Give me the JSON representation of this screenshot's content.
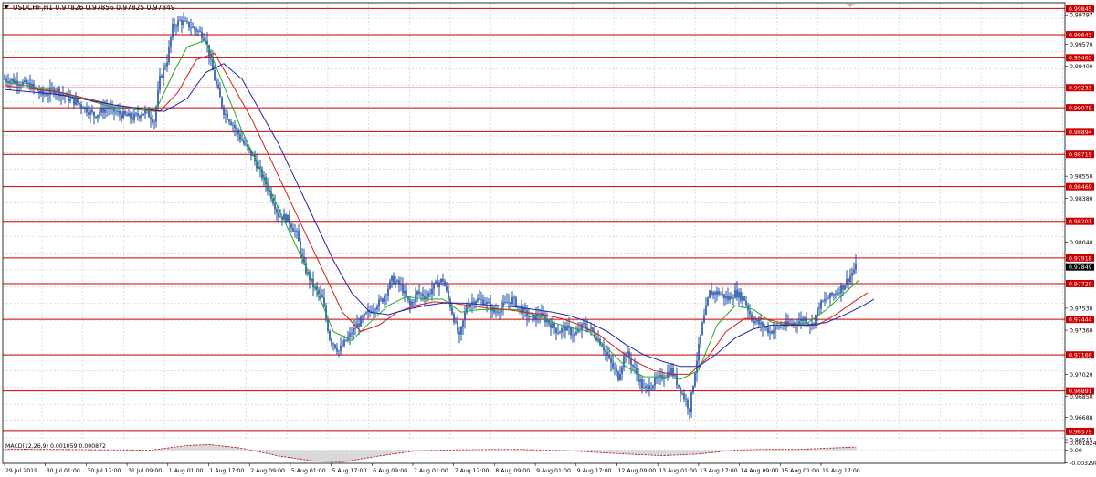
{
  "header": {
    "symbol_line": "USDCHF,H1  0.97826 0.97856 0.97825 0.97849"
  },
  "colors": {
    "background": "#ffffff",
    "grid": "#c8c8c8",
    "candles": "#1f4fa8",
    "sr_lines": "#cc0000",
    "ma_fast": "#22aa22",
    "ma_mid": "#cc2222",
    "ma_slow": "#2222aa",
    "macd_hist": "#a0a0a0",
    "macd_signal": "#cc0000",
    "price_label_bg": "#cc0000",
    "current_price_bg": "#000000"
  },
  "price_axis": {
    "plain_labels": [
      "0.99797",
      "0.99570",
      "0.99400",
      "0.98550",
      "0.98380",
      "0.98040",
      "0.97530",
      "0.97360",
      "0.97020",
      "0.96850",
      "0.96688",
      "0.96515"
    ],
    "current_price": "0.97849"
  },
  "sr_levels": [
    "0.99845",
    "0.99643",
    "0.99465",
    "0.99233",
    "0.99079",
    "0.98894",
    "0.98719",
    "0.98469",
    "0.98201",
    "0.97918",
    "0.97720",
    "0.97444",
    "0.97169",
    "0.96891",
    "0.96579"
  ],
  "time_axis": {
    "labels": [
      "29 Jul 2019",
      "30 Jul 01:00",
      "30 Jul 17:00",
      "31 Jul 09:00",
      "1 Aug 01:00",
      "1 Aug 17:00",
      "2 Aug 09:00",
      "5 Aug 01:00",
      "5 Aug 17:00",
      "6 Aug 09:00",
      "7 Aug 01:00",
      "7 Aug 17:00",
      "8 Aug 09:00",
      "9 Aug 01:00",
      "9 Aug 17:00",
      "12 Aug 09:00",
      "13 Aug 01:00",
      "13 Aug 17:00",
      "14 Aug 09:00",
      "15 Aug 01:00",
      "15 Aug 17:00"
    ]
  },
  "macd": {
    "label": "MACD(12,26,9) 0.001059 0.000872",
    "axis_labels": [
      "0.001824",
      "0.00",
      "-0.003298"
    ]
  },
  "chart_data": {
    "type": "candlestick",
    "title": "USDCHF,H1",
    "ylim": [
      0.96515,
      0.9989
    ],
    "x_start": "29 Jul 2019",
    "close_path": [
      [
        0,
        0.993
      ],
      [
        14,
        0.9928
      ],
      [
        28,
        0.9925
      ],
      [
        42,
        0.9918
      ],
      [
        56,
        0.9922
      ],
      [
        70,
        0.9915
      ],
      [
        84,
        0.991
      ],
      [
        98,
        0.9902
      ],
      [
        112,
        0.9908
      ],
      [
        126,
        0.9903
      ],
      [
        140,
        0.99
      ],
      [
        154,
        0.9905
      ],
      [
        164,
        0.9898
      ],
      [
        170,
        0.993
      ],
      [
        178,
        0.9945
      ],
      [
        184,
        0.997
      ],
      [
        192,
        0.9975
      ],
      [
        200,
        0.9972
      ],
      [
        210,
        0.9968
      ],
      [
        220,
        0.9962
      ],
      [
        230,
        0.993
      ],
      [
        240,
        0.9905
      ],
      [
        250,
        0.9895
      ],
      [
        262,
        0.988
      ],
      [
        272,
        0.987
      ],
      [
        282,
        0.9855
      ],
      [
        292,
        0.984
      ],
      [
        300,
        0.9825
      ],
      [
        310,
        0.9822
      ],
      [
        320,
        0.981
      ],
      [
        328,
        0.9785
      ],
      [
        338,
        0.977
      ],
      [
        348,
        0.976
      ],
      [
        356,
        0.973
      ],
      [
        366,
        0.972
      ],
      [
        376,
        0.973
      ],
      [
        386,
        0.974
      ],
      [
        396,
        0.9748
      ],
      [
        406,
        0.9755
      ],
      [
        414,
        0.976
      ],
      [
        424,
        0.9775
      ],
      [
        434,
        0.977
      ],
      [
        444,
        0.9755
      ],
      [
        452,
        0.9765
      ],
      [
        462,
        0.9762
      ],
      [
        470,
        0.977
      ],
      [
        480,
        0.9775
      ],
      [
        490,
        0.975
      ],
      [
        498,
        0.973
      ],
      [
        506,
        0.9755
      ],
      [
        516,
        0.976
      ],
      [
        526,
        0.9758
      ],
      [
        536,
        0.975
      ],
      [
        546,
        0.9755
      ],
      [
        556,
        0.976
      ],
      [
        566,
        0.9752
      ],
      [
        576,
        0.9745
      ],
      [
        586,
        0.9748
      ],
      [
        596,
        0.9742
      ],
      [
        606,
        0.9735
      ],
      [
        614,
        0.9738
      ],
      [
        624,
        0.9732
      ],
      [
        634,
        0.974
      ],
      [
        644,
        0.9735
      ],
      [
        654,
        0.9725
      ],
      [
        664,
        0.971
      ],
      [
        672,
        0.97
      ],
      [
        680,
        0.972
      ],
      [
        690,
        0.9705
      ],
      [
        700,
        0.969
      ],
      [
        710,
        0.9695
      ],
      [
        720,
        0.97
      ],
      [
        730,
        0.9705
      ],
      [
        740,
        0.969
      ],
      [
        750,
        0.9675
      ],
      [
        756,
        0.9705
      ],
      [
        764,
        0.974
      ],
      [
        772,
        0.9765
      ],
      [
        782,
        0.9765
      ],
      [
        792,
        0.976
      ],
      [
        800,
        0.9765
      ],
      [
        810,
        0.976
      ],
      [
        818,
        0.9745
      ],
      [
        828,
        0.974
      ],
      [
        838,
        0.9735
      ],
      [
        846,
        0.9738
      ],
      [
        856,
        0.974
      ],
      [
        866,
        0.9742
      ],
      [
        876,
        0.9745
      ],
      [
        884,
        0.974
      ],
      [
        892,
        0.9755
      ],
      [
        900,
        0.976
      ],
      [
        910,
        0.9765
      ],
      [
        918,
        0.977
      ],
      [
        926,
        0.9778
      ],
      [
        932,
        0.9785
      ]
    ],
    "ma_fast_path": [
      [
        0,
        0.9928
      ],
      [
        60,
        0.992
      ],
      [
        120,
        0.9908
      ],
      [
        165,
        0.9905
      ],
      [
        185,
        0.9935
      ],
      [
        200,
        0.9955
      ],
      [
        220,
        0.996
      ],
      [
        240,
        0.9925
      ],
      [
        260,
        0.989
      ],
      [
        280,
        0.986
      ],
      [
        300,
        0.983
      ],
      [
        320,
        0.98
      ],
      [
        340,
        0.977
      ],
      [
        360,
        0.9735
      ],
      [
        380,
        0.9728
      ],
      [
        400,
        0.9742
      ],
      [
        420,
        0.9755
      ],
      [
        440,
        0.9762
      ],
      [
        460,
        0.976
      ],
      [
        480,
        0.976
      ],
      [
        500,
        0.975
      ],
      [
        520,
        0.9752
      ],
      [
        540,
        0.9752
      ],
      [
        560,
        0.9752
      ],
      [
        580,
        0.9748
      ],
      [
        600,
        0.9742
      ],
      [
        620,
        0.9738
      ],
      [
        640,
        0.9735
      ],
      [
        660,
        0.9722
      ],
      [
        680,
        0.9708
      ],
      [
        700,
        0.97
      ],
      [
        720,
        0.97
      ],
      [
        740,
        0.9698
      ],
      [
        760,
        0.9705
      ],
      [
        780,
        0.974
      ],
      [
        800,
        0.9755
      ],
      [
        820,
        0.9752
      ],
      [
        840,
        0.9742
      ],
      [
        860,
        0.974
      ],
      [
        880,
        0.9742
      ],
      [
        900,
        0.9752
      ],
      [
        920,
        0.9765
      ],
      [
        936,
        0.9775
      ]
    ],
    "ma_mid_path": [
      [
        0,
        0.9925
      ],
      [
        60,
        0.992
      ],
      [
        120,
        0.991
      ],
      [
        170,
        0.9905
      ],
      [
        190,
        0.992
      ],
      [
        210,
        0.9945
      ],
      [
        230,
        0.995
      ],
      [
        250,
        0.9925
      ],
      [
        270,
        0.99
      ],
      [
        290,
        0.987
      ],
      [
        310,
        0.984
      ],
      [
        330,
        0.981
      ],
      [
        350,
        0.978
      ],
      [
        370,
        0.975
      ],
      [
        390,
        0.9735
      ],
      [
        410,
        0.974
      ],
      [
        430,
        0.975
      ],
      [
        450,
        0.9755
      ],
      [
        470,
        0.9758
      ],
      [
        490,
        0.9757
      ],
      [
        510,
        0.9755
      ],
      [
        530,
        0.9753
      ],
      [
        550,
        0.9752
      ],
      [
        570,
        0.975
      ],
      [
        590,
        0.9748
      ],
      [
        610,
        0.9745
      ],
      [
        630,
        0.974
      ],
      [
        650,
        0.9733
      ],
      [
        670,
        0.9722
      ],
      [
        690,
        0.9712
      ],
      [
        710,
        0.9705
      ],
      [
        730,
        0.9702
      ],
      [
        750,
        0.9702
      ],
      [
        770,
        0.9715
      ],
      [
        790,
        0.9735
      ],
      [
        810,
        0.9745
      ],
      [
        830,
        0.9745
      ],
      [
        850,
        0.9742
      ],
      [
        870,
        0.974
      ],
      [
        890,
        0.974
      ],
      [
        910,
        0.9748
      ],
      [
        930,
        0.9758
      ],
      [
        945,
        0.9765
      ]
    ],
    "ma_slow_path": [
      [
        0,
        0.9922
      ],
      [
        60,
        0.9918
      ],
      [
        120,
        0.991
      ],
      [
        175,
        0.9905
      ],
      [
        200,
        0.9915
      ],
      [
        220,
        0.9935
      ],
      [
        240,
        0.9942
      ],
      [
        260,
        0.993
      ],
      [
        280,
        0.9905
      ],
      [
        300,
        0.988
      ],
      [
        320,
        0.985
      ],
      [
        340,
        0.982
      ],
      [
        360,
        0.979
      ],
      [
        380,
        0.9765
      ],
      [
        400,
        0.975
      ],
      [
        420,
        0.9748
      ],
      [
        440,
        0.9752
      ],
      [
        460,
        0.9755
      ],
      [
        480,
        0.9757
      ],
      [
        500,
        0.9757
      ],
      [
        520,
        0.9756
      ],
      [
        540,
        0.9755
      ],
      [
        560,
        0.9754
      ],
      [
        580,
        0.9752
      ],
      [
        600,
        0.975
      ],
      [
        620,
        0.9747
      ],
      [
        640,
        0.9742
      ],
      [
        660,
        0.9735
      ],
      [
        680,
        0.9725
      ],
      [
        700,
        0.9717
      ],
      [
        720,
        0.9712
      ],
      [
        740,
        0.9708
      ],
      [
        760,
        0.9708
      ],
      [
        780,
        0.9718
      ],
      [
        800,
        0.973
      ],
      [
        820,
        0.9737
      ],
      [
        840,
        0.974
      ],
      [
        860,
        0.974
      ],
      [
        880,
        0.974
      ],
      [
        900,
        0.9742
      ],
      [
        920,
        0.9748
      ],
      [
        940,
        0.9755
      ],
      [
        952,
        0.976
      ]
    ],
    "macd_signal_path": [
      [
        0,
        0.0003
      ],
      [
        100,
        0.0001
      ],
      [
        160,
        0.0
      ],
      [
        200,
        0.0012
      ],
      [
        225,
        0.0014
      ],
      [
        260,
        0.0005
      ],
      [
        300,
        -0.0015
      ],
      [
        340,
        -0.0028
      ],
      [
        370,
        -0.003
      ],
      [
        410,
        -0.0015
      ],
      [
        450,
        -0.0002
      ],
      [
        500,
        0.0001
      ],
      [
        560,
        0.0002
      ],
      [
        620,
        -0.0002
      ],
      [
        680,
        -0.001
      ],
      [
        720,
        -0.0014
      ],
      [
        760,
        -0.001
      ],
      [
        800,
        0.0
      ],
      [
        830,
        0.0002
      ],
      [
        870,
        0.0002
      ],
      [
        900,
        0.0005
      ],
      [
        932,
        0.0008
      ]
    ]
  }
}
